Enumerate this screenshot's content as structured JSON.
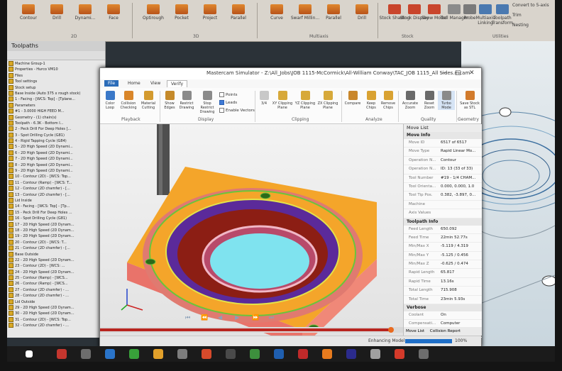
{
  "main_ribbon": {
    "buttons": [
      "Contour",
      "Drill",
      "Dynami...",
      "Face",
      "Optirough",
      "Pocket",
      "Project",
      "Parallel",
      "Curve",
      "Swarf Millin...",
      "Parallel",
      "Drill",
      "Stock Shading",
      "Stock Display",
      "Show Model",
      "Tool Manager",
      "Probe",
      "Multiaxis Linking",
      "Toolpath Transform",
      "Convert to 5-axis",
      "Trim",
      "Nesting"
    ],
    "groups": [
      "2D",
      "3D",
      "Multiaxis",
      "Stock",
      "Utilities"
    ]
  },
  "toolpaths_panel": {
    "title": "Toolpaths",
    "items": [
      "Machine Group-1",
      "Properties - Hurco VM10",
      "Files",
      "Tool settings",
      "Stock setup",
      "Base Inside (Auto 375 x rough stock)",
      "1 - Facing - [WCS: Top] - [Tplane...",
      "Parameters",
      "#1 - 3.0000 HIGH FEED M...",
      "Geometry - (1) chain(s)",
      "Toolpath - 6.3K - Bottom I...",
      "2 - Peck Drill For Deep Holes [...",
      "3 - Spot Drilling Cycle (G81)",
      "4 - Rigid Tapping Cycle (G84)",
      "5 - 2D High Speed (2D Dynami...",
      "6 - 2D High Speed (2D Dynami...",
      "7 - 2D High Speed (2D Dynami...",
      "8 - 2D High Speed (2D Dynami...",
      "9 - 2D High Speed (2D Dynami...",
      "10 - Contour (2D) - [WCS: Top...",
      "11 - Contour (Ramp) - [WCS: T...",
      "12 - Contour (2D chamfer) - [...",
      "13 - Contour (2D chamfer) - [...",
      "Lid Inside",
      "14 - Facing - [WCS: Top] - [Tp...",
      "15 - Peck Drill For Deep Holes ...",
      "16 - Spot Drilling Cycle (G81)",
      "17 - 2D High Speed (2D Dynam...",
      "18 - 2D High Speed (2D Dynam...",
      "19 - 2D High Speed (2D Dynam...",
      "20 - Contour (2D) - [WCS: T...",
      "21 - Contour (2D chamfer) - [...",
      "Base Outside",
      "22 - 2D High Speed (2D Dynam...",
      "23 - Contour (2D) - [WCS: ...",
      "24 - 2D High Speed (2D Dynam...",
      "25 - Contour (Ramp) - [WCS...",
      "26 - Contour (Ramp) - [WCS...",
      "27 - Contour (2D chamfer) - ...",
      "28 - Contour (2D chamfer) - ...",
      "Lid Outside",
      "29 - 2D High Speed (2D Dynam...",
      "30 - 2D High Speed (2D Dynam...",
      "31 - Contour (2D) - [WCS: Top...",
      "32 - Contour (2D chamfer) - ..."
    ]
  },
  "simulator": {
    "title": "Mastercam Simulator - Z:\\All_Jobs\\JOB 1115-McCormick\\All-William Conway\\TAC_JOB 1115_All Sides.mcam",
    "tabs": [
      "File",
      "Home",
      "View",
      "Verify"
    ],
    "ribbon_buttons": [
      "Color Loop",
      "Collision Checking",
      "Material Cutting",
      "Show Edges",
      "Restrict Drawing",
      "Stop Restrict Drawing",
      "3/4",
      "XY Clipping Plane",
      "YZ Clipping Plane",
      "ZX Clipping Plane",
      "Compare",
      "Keep Chips",
      "Remove Chips",
      "Accurate Zoom",
      "Reset Zoom",
      "Turbo Mode",
      "Save Stock as STL"
    ],
    "checkboxes": [
      {
        "label": "Points",
        "on": false
      },
      {
        "label": "Leads",
        "on": true
      },
      {
        "label": "Enable Vectors",
        "on": false
      }
    ],
    "ribbon_groups": [
      "Playback",
      "Display",
      "Clipping",
      "Analyze",
      "Quality",
      "Geometry"
    ]
  },
  "move_list": {
    "title": "Move List",
    "sections": [
      {
        "name": "Move Info",
        "rows": [
          {
            "key": "Move ID",
            "value": "6517 of 6517"
          },
          {
            "key": "Move Type",
            "value": "Rapid Linear Mo..."
          },
          {
            "key": "Operation N...",
            "value": "Contour"
          },
          {
            "key": "Operation N...",
            "value": "ID: 13 (33 of 33)"
          },
          {
            "key": "Tool Number",
            "value": "#19 - 1/4 CHAM..."
          },
          {
            "key": "Tool Orienta...",
            "value": "0.000, 0.000, 1.0"
          },
          {
            "key": "Tool Tip Pos.",
            "value": "0.382, -3.897, 0..."
          },
          {
            "key": "Machine",
            "value": ""
          },
          {
            "key": "Axis Values",
            "value": ""
          }
        ]
      },
      {
        "name": "Toolpath Info",
        "rows": [
          {
            "key": "Feed Length",
            "value": "650.092"
          },
          {
            "key": "Feed Time",
            "value": "22min 52.77s"
          },
          {
            "key": "Min/Max X",
            "value": "-5.119 / 4.319"
          },
          {
            "key": "Min/Max Y",
            "value": "-5.125 / 0.456"
          },
          {
            "key": "Min/Max Z",
            "value": "-0.625 / 0.474"
          },
          {
            "key": "Rapid Length",
            "value": "65.817"
          },
          {
            "key": "Rapid Time",
            "value": "13.16s"
          },
          {
            "key": "Total Length",
            "value": "715.908"
          },
          {
            "key": "Total Time",
            "value": "23min 5.93s"
          }
        ]
      },
      {
        "name": "Verbose",
        "rows": [
          {
            "key": "Coolant",
            "value": "On"
          },
          {
            "key": "Compensati...",
            "value": "Computer"
          },
          {
            "key": "Compensati...",
            "value": "Left"
          }
        ]
      }
    ],
    "bottom_tabs": [
      "Move List",
      "Collision Report"
    ]
  },
  "status": {
    "text": "Enhancing Model",
    "percent_label": "100%",
    "progress": 1.0,
    "playback_progress": 0.96
  },
  "colors": {
    "stock_top": "#f4a52a",
    "stock_side": "#e9736a",
    "pocket_wall": "#8c1e14",
    "inner_floor": "#7fe3ef",
    "purple_band": "#5b2a9a",
    "green_edge": "#69c53b"
  }
}
